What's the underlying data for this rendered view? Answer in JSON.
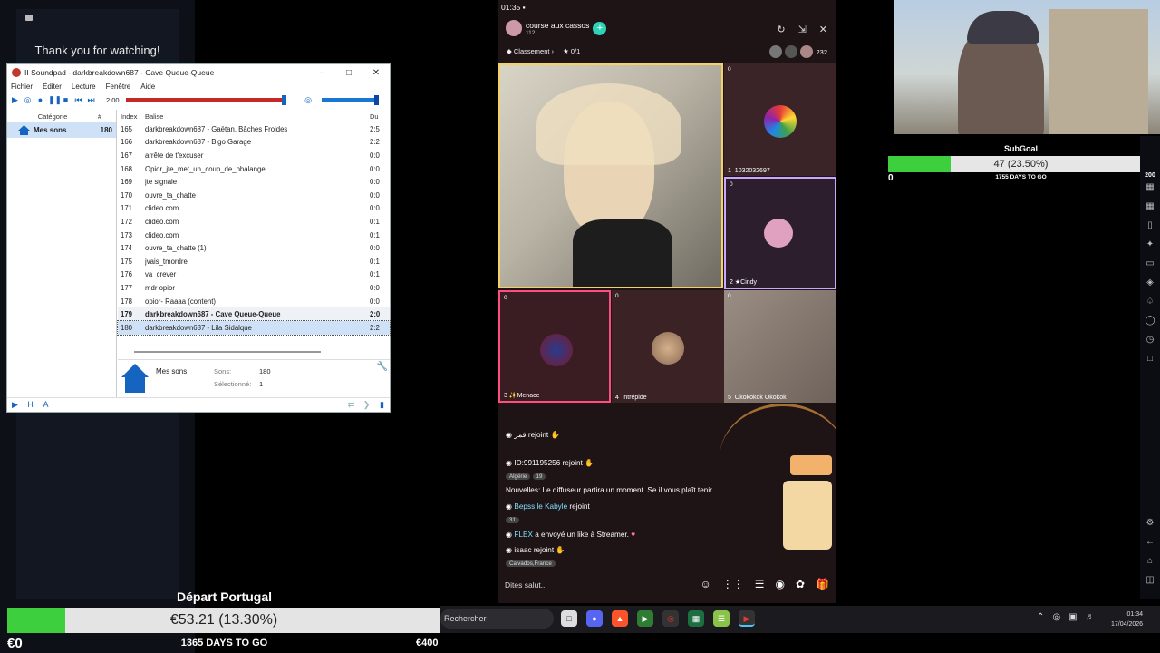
{
  "thanks_text": "Thank you for watching!",
  "soundpad": {
    "title": "II Soundpad - darkbreakdown687 - Cave Queue-Queue",
    "menu": [
      "Fichier",
      "Éditer",
      "Lecture",
      "Fenêtre",
      "Aide"
    ],
    "time": "2:00",
    "playback_progress": 0.98,
    "volume_level": 1.0,
    "cat_header": {
      "category": "Catégorie",
      "count": "#"
    },
    "category": {
      "name": "Mes sons",
      "count": "180"
    },
    "list_header": {
      "index": "Index",
      "tag": "Balise",
      "duration": "Du"
    },
    "rows": [
      {
        "idx": "165",
        "name": "darkbreakdown687 - Gaëtan, Bâches Froides",
        "dur": "2:5"
      },
      {
        "idx": "166",
        "name": "darkbreakdown687 - Bigo Garage",
        "dur": "2:2"
      },
      {
        "idx": "167",
        "name": "arrête de t'excuser",
        "dur": "0:0"
      },
      {
        "idx": "168",
        "name": "Opior_jte_met_un_coup_de_phalange",
        "dur": "0:0"
      },
      {
        "idx": "169",
        "name": "jte signale",
        "dur": "0:0"
      },
      {
        "idx": "170",
        "name": "ouvre_ta_chatte",
        "dur": "0:0"
      },
      {
        "idx": "171",
        "name": "clideo.com",
        "dur": "0:0"
      },
      {
        "idx": "172",
        "name": "clideo.com",
        "dur": "0:1"
      },
      {
        "idx": "173",
        "name": "clideo.com",
        "dur": "0:1"
      },
      {
        "idx": "174",
        "name": "ouvre_ta_chatte (1)",
        "dur": "0:0"
      },
      {
        "idx": "175",
        "name": "jvais_tmordre",
        "dur": "0:1"
      },
      {
        "idx": "176",
        "name": "va_crever",
        "dur": "0:1"
      },
      {
        "idx": "177",
        "name": "mdr opior",
        "dur": "0:0"
      },
      {
        "idx": "178",
        "name": "opior- Raaaa (content)",
        "dur": "0:0"
      },
      {
        "idx": "179",
        "name": "darkbreakdown687 - Cave Queue-Queue",
        "dur": "2:0"
      },
      {
        "idx": "180",
        "name": "darkbreakdown687 - Lila Sidalque",
        "dur": "2:2"
      }
    ],
    "info": {
      "name": "Mes sons",
      "sons_label": "Sons:",
      "sons_value": "180",
      "sel_label": "Sélectionné:",
      "sel_value": "1"
    }
  },
  "live": {
    "clock": "01:35",
    "host_name": "course aux cassos",
    "host_likes": "112",
    "ranking": "Classement",
    "star_count": "0/1",
    "viewers": "232",
    "slots": [
      {
        "n": "1",
        "name": "1032032697"
      },
      {
        "n": "2",
        "name": "Cindy"
      },
      {
        "n": "3",
        "name": "Menace"
      },
      {
        "n": "4",
        "name": "intrépide"
      },
      {
        "n": "5",
        "name": "Okokokok Okokok"
      }
    ],
    "badge_zero": "0",
    "chat": [
      {
        "user": "قمر",
        "text": "rejoint"
      },
      {
        "user": "ID:991195256",
        "text": "rejoint",
        "tag": "Algérie",
        "tag2": "19"
      },
      {
        "user": "Nouvelles:",
        "text": "Le diffuseur partira un moment. Se il vous plaît tenir"
      },
      {
        "user": "Bepss le Kabyle",
        "text": "rejoint",
        "tag2": "31"
      },
      {
        "user": "FLEX",
        "text": "a envoyé un like à Streamer."
      },
      {
        "user": "isaac",
        "text": "rejoint",
        "tag": "Calvados,France"
      }
    ],
    "input_placeholder": "Dites salut..."
  },
  "subgoal": {
    "title": "SubGoal",
    "progress_text": "47 (23.50%)",
    "progress": 0.235,
    "min": "0",
    "max": "200",
    "days": "1755 DAYS TO GO"
  },
  "goal": {
    "title": "Départ Portugal",
    "progress_text": "€53.21 (13.30%)",
    "progress": 0.133,
    "min": "€0",
    "max": "€400",
    "days": "1365 DAYS TO GO"
  },
  "taskbar": {
    "search": "Rechercher",
    "time": "01:34",
    "date": "17/04/2026"
  },
  "colors": {
    "goal_fill": "#3ecf3e",
    "accent": "#2ed3b7",
    "soundpad_progress": "#c62828"
  }
}
